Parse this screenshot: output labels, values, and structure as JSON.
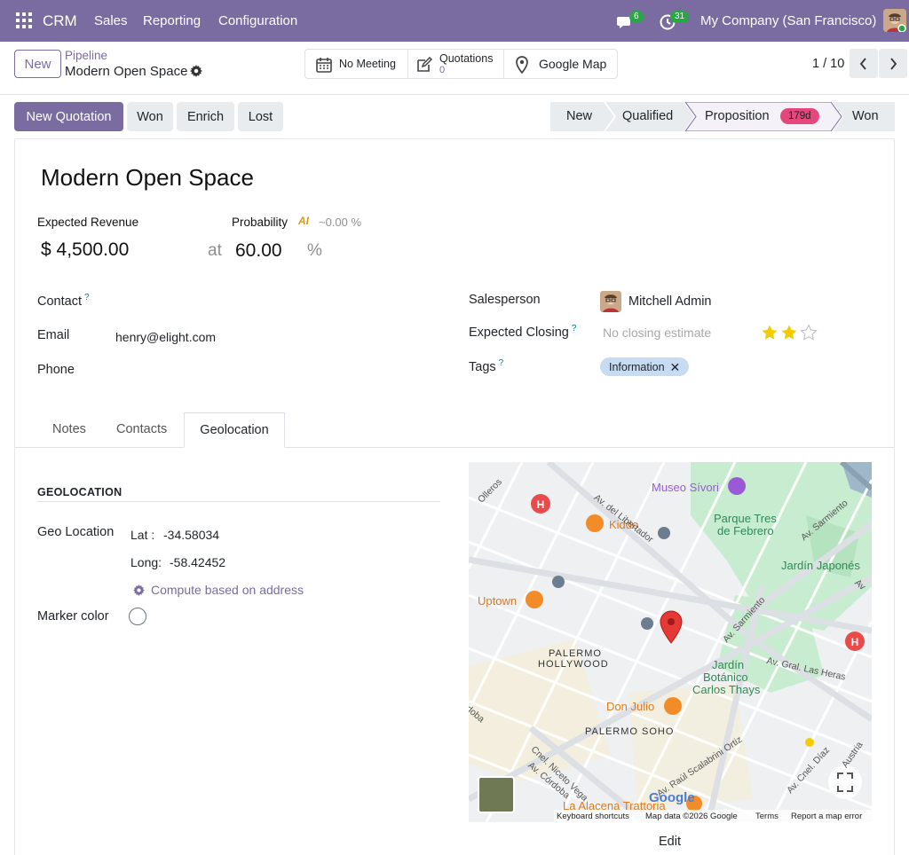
{
  "topbar": {
    "brand": "CRM",
    "menu": [
      "Sales",
      "Reporting",
      "Configuration"
    ],
    "messages_count": "6",
    "activities_count": "31",
    "company": "My Company (San Francisco)"
  },
  "control": {
    "new_label": "New",
    "breadcrumb_parent": "Pipeline",
    "breadcrumb_current": "Modern Open Space",
    "smart_meeting": "No Meeting",
    "smart_quotations_label": "Quotations",
    "smart_quotations_count": "0",
    "smart_map": "Google Map",
    "pager": "1 / 10"
  },
  "actions": {
    "new_quotation": "New Quotation",
    "won": "Won",
    "enrich": "Enrich",
    "lost": "Lost"
  },
  "stages": {
    "items": [
      "New",
      "Qualified",
      "Proposition",
      "Won"
    ],
    "current": "Proposition",
    "current_badge": "179d"
  },
  "record": {
    "title": "Modern Open Space",
    "expected_revenue_label": "Expected Revenue",
    "expected_revenue": "$ 4,500.00",
    "probability_label": "Probability",
    "ai_label": "AI",
    "ai_probability": "~0.00 %",
    "at": "at",
    "probability": "60.00",
    "percent": "%",
    "contact_label": "Contact",
    "email_label": "Email",
    "email": "henry@elight.com",
    "phone_label": "Phone",
    "salesperson_label": "Salesperson",
    "salesperson": "Mitchell Admin",
    "expected_closing_label": "Expected Closing",
    "expected_closing_placeholder": "No closing estimate",
    "priority_stars": 2,
    "priority_max": 3,
    "tags_label": "Tags",
    "tag": "Information",
    "help_mark": "?"
  },
  "tabs": [
    "Notes",
    "Contacts",
    "Geolocation"
  ],
  "active_tab": "Geolocation",
  "geo": {
    "section_title": "GEOLOCATION",
    "geo_location_label": "Geo Location",
    "lat_label": "Lat :",
    "lat": "-34.58034",
    "long_label": "Long:",
    "long": "-58.42452",
    "compute": "Compute based on address",
    "marker_color_label": "Marker color",
    "edit": "Edit"
  },
  "map": {
    "labels": {
      "museo": "Museo Sívori",
      "kiddo": "Kiddo",
      "parque": "Parque Tres",
      "parque2": "de Febrero",
      "jardin_japones": "Jardín Japonés",
      "uptown": "Uptown",
      "palermo_h1": "PALERMO",
      "palermo_h2": "HOLLYWOOD",
      "botanico1": "Jardín",
      "botanico2": "Botánico",
      "botanico3": "Carlos Thays",
      "don_julio": "Don Julio",
      "palermo_soho": "PALERMO SOHO",
      "alacena": "La Alacena Trattoria",
      "libertador": "Av. del Libertador",
      "sarmiento": "Av. Sarmiento",
      "sarmiento2": "Av. Sarmiento",
      "heras": "Av. Gral. Las Heras",
      "scalabrini": "Av. Raúl Scalabrini Ortiz",
      "nicetovega": "Cnel. Niceto Vega",
      "cordoba": "Av. Córdoba",
      "diaz": "Av. Cnel. Díaz",
      "olleros": "Olleros",
      "austria": "Austria",
      "av": "Av",
      "oba": "doba"
    },
    "footer": {
      "shortcuts": "Keyboard shortcuts",
      "mapdata": "Map data ©2026 Google",
      "terms": "Terms",
      "report": "Report a map error",
      "google": "Google"
    },
    "colors": {
      "park": "#c8ecd0",
      "road": "#ffffff",
      "food": "#f28c28",
      "hospital": "#e94b4b",
      "museum": "#9a5ad6",
      "pin": "#e53935"
    }
  },
  "colors": {
    "primary": "#7a6ba0",
    "badge_green": "#28a745",
    "stage_badge": "#e3477b",
    "tag_bg": "#c7dcf3",
    "star": "#f3cc00"
  }
}
